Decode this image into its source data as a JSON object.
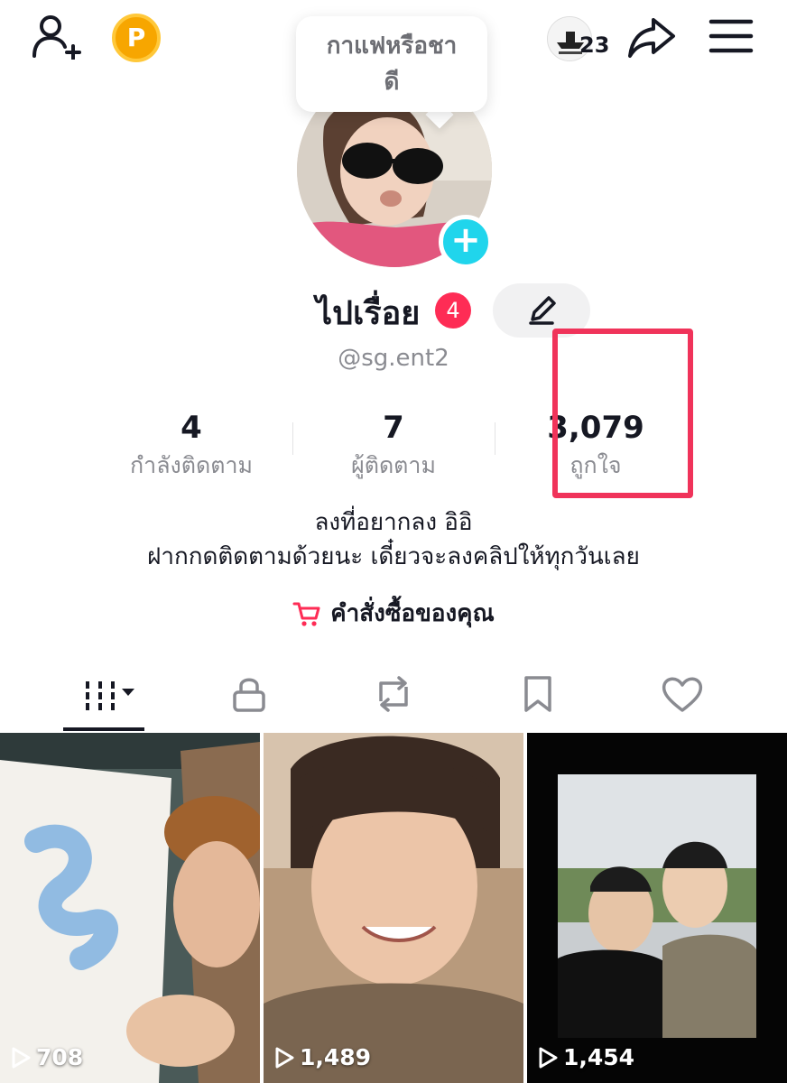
{
  "header": {
    "coin_label": "P",
    "notification_count": "23",
    "tooltip_text": "กาแฟหรือชา ดี"
  },
  "profile": {
    "display_name": "ไปเรื่อย",
    "name_badge": "4",
    "username": "@sg.ent2",
    "bio_line1": "ลงที่อยากลง อิอิ",
    "bio_line2": "ฝากกดติดตามด้วยนะ เดี๋ยวจะลงคลิปให้ทุกวันเลย",
    "orders_label": "คำสั่งซื้อของคุณ"
  },
  "stats": [
    {
      "value": "4",
      "label": "กำลังติดตาม"
    },
    {
      "value": "7",
      "label": "ผู้ติดตาม"
    },
    {
      "value": "3,079",
      "label": "ถูกใจ"
    }
  ],
  "tabs": [
    {
      "icon": "grid-icon",
      "active": true
    },
    {
      "icon": "lock-icon",
      "active": false
    },
    {
      "icon": "repost-icon",
      "active": false
    },
    {
      "icon": "bookmark-icon",
      "active": false
    },
    {
      "icon": "heart-icon",
      "active": false
    }
  ],
  "videos": [
    {
      "views": "708"
    },
    {
      "views": "1,489"
    },
    {
      "views": "1,454"
    }
  ],
  "colors": {
    "accent_red": "#fe2c55",
    "avatar_add": "#20d5ec",
    "highlight": "#f0335a",
    "coin": "#f7a600"
  }
}
